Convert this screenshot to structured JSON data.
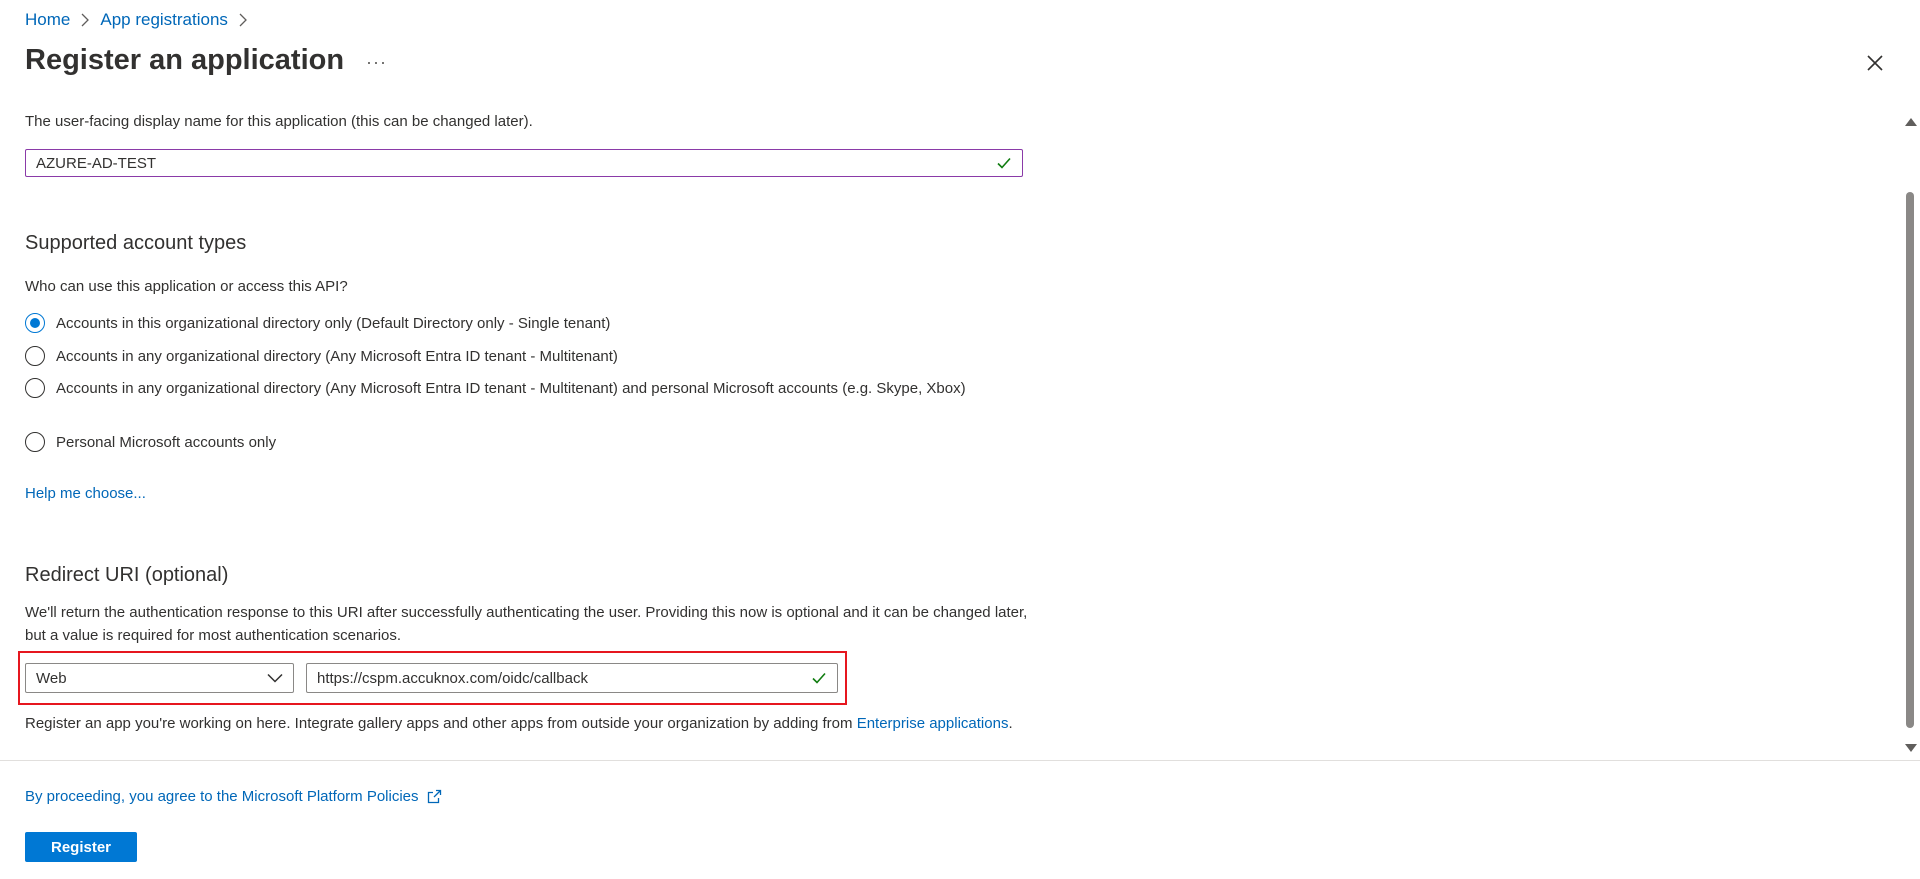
{
  "breadcrumb": {
    "items": [
      "Home",
      "App registrations"
    ]
  },
  "header": {
    "title": "Register an application",
    "more": "···"
  },
  "name_section": {
    "description": "The user-facing display name for this application (this can be changed later).",
    "value": "AZURE-AD-TEST"
  },
  "account_types": {
    "title": "Supported account types",
    "question": "Who can use this application or access this API?",
    "options": [
      "Accounts in this organizational directory only (Default Directory only - Single tenant)",
      "Accounts in any organizational directory (Any Microsoft Entra ID tenant - Multitenant)",
      "Accounts in any organizational directory (Any Microsoft Entra ID tenant - Multitenant) and personal Microsoft accounts (e.g. Skype, Xbox)",
      "Personal Microsoft accounts only"
    ],
    "selected_index": 0,
    "help_link": "Help me choose..."
  },
  "redirect": {
    "title": "Redirect URI (optional)",
    "description": "We'll return the authentication response to this URI after successfully authenticating the user. Providing this now is optional and it can be changed later, but a value is required for most authentication scenarios.",
    "platform": "Web",
    "uri": "https://cspm.accuknox.com/oidc/callback",
    "note": "Register an app you're working on here. Integrate gallery apps and other apps from outside your organization by adding from ",
    "note_link": "Enterprise applications",
    "note_end": "."
  },
  "footer": {
    "policy_link": "By proceeding, you agree to the Microsoft Platform Policies",
    "register_label": "Register"
  },
  "colors": {
    "accent": "#0078d4",
    "link": "#0067b8",
    "highlight_border": "#e6171f",
    "valid_check": "#107c10"
  }
}
